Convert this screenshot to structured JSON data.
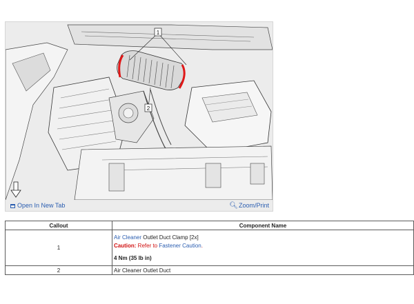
{
  "figure": {
    "callout_labels": [
      "1",
      "2"
    ],
    "open_tab_label": "Open In New Tab",
    "zoom_label": "Zoom/Print",
    "open_tab_icon": "external-tab-icon",
    "zoom_icon": "magnifier-icon",
    "clamp_highlight_color": "#e01818"
  },
  "table": {
    "headers": {
      "callout": "Callout",
      "component": "Component Name"
    },
    "rows": [
      {
        "callout": "1",
        "name_link": "Air Cleaner",
        "name_rest": " Outlet Duct Clamp [2x]",
        "caution_label": "Caution:",
        "caution_text_pre": " Refer to ",
        "caution_link": "Fastener Caution",
        "caution_text_post": ".",
        "torque": "4 Nm (35 lb in)"
      },
      {
        "callout": "2",
        "name": "Air Cleaner Outlet Duct"
      }
    ]
  }
}
